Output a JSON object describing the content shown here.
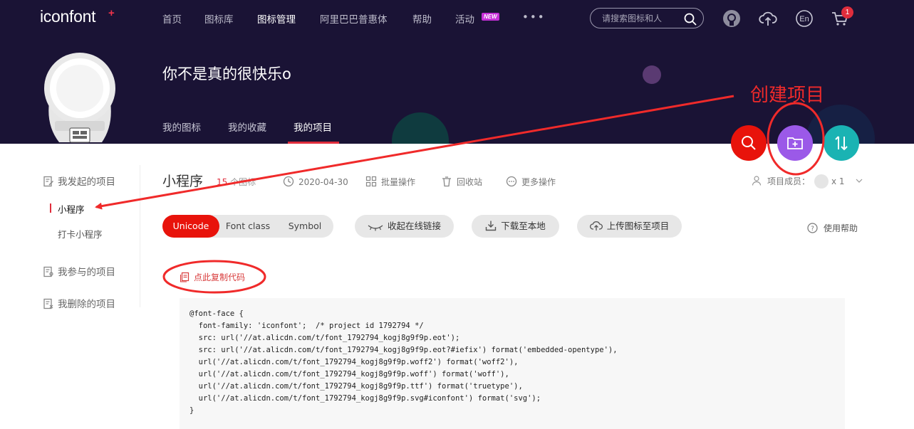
{
  "header": {
    "logo": "iconfont",
    "logo_plus": "+",
    "nav": [
      "首页",
      "图标库",
      "图标管理",
      "阿里巴巴普惠体",
      "帮助",
      "活动"
    ],
    "active_nav": "图标管理",
    "new_badge": "NEW",
    "more": "•••",
    "search_placeholder": "请搜索图标和人",
    "cart_count": "1",
    "icons": [
      "github-icon",
      "upload-icon",
      "language-en-icon",
      "cart-icon"
    ],
    "lang_label": "En"
  },
  "profile": {
    "name": "你不是真的很快乐o",
    "tabs": [
      "我的图标",
      "我的收藏",
      "我的项目"
    ],
    "active_tab": "我的项目"
  },
  "fab": {
    "search": "search-icon",
    "create": "folder-add-icon",
    "sort": "sort-icon"
  },
  "sidebar": {
    "groups": [
      {
        "label": "我发起的项目",
        "items": [
          "小程序",
          "打卡小程序"
        ]
      },
      {
        "label": "我参与的项目",
        "items": []
      },
      {
        "label": "我删除的项目",
        "items": []
      }
    ],
    "active_item": "小程序"
  },
  "project": {
    "title": "小程序",
    "count": "15",
    "count_suffix": "个图标",
    "date": "2020-04-30",
    "batch": "批量操作",
    "trash": "回收站",
    "more": "更多操作",
    "members_label": "项目成员：",
    "members_count": "x 1"
  },
  "toolbar": {
    "tabs": [
      "Unicode",
      "Font class",
      "Symbol"
    ],
    "active_tab": "Unicode",
    "collapse_link": "收起在线链接",
    "download": "下载至本地",
    "upload": "上传图标至项目",
    "help": "使用帮助"
  },
  "code": {
    "copy_label": "点此复制代码",
    "lines": [
      "@font-face {",
      "  font-family: 'iconfont';  /* project id 1792794 */",
      "  src: url('//at.alicdn.com/t/font_1792794_kogj8g9f9p.eot');",
      "  src: url('//at.alicdn.com/t/font_1792794_kogj8g9f9p.eot?#iefix') format('embedded-opentype'),",
      "  url('//at.alicdn.com/t/font_1792794_kogj8g9f9p.woff2') format('woff2'),",
      "  url('//at.alicdn.com/t/font_1792794_kogj8g9f9p.woff') format('woff'),",
      "  url('//at.alicdn.com/t/font_1792794_kogj8g9f9p.ttf') format('truetype'),",
      "  url('//at.alicdn.com/t/font_1792794_kogj8g9f9p.svg#iconfont') format('svg');",
      "}"
    ]
  },
  "annotation": {
    "text": "创建项目"
  },
  "colors": {
    "header_bg": "#1a1335",
    "accent_red": "#e8130b",
    "fab_search": "#e8130b",
    "fab_create": "#9b59e8",
    "fab_sort": "#1ab3b3",
    "annotation": "#f02a2a"
  }
}
